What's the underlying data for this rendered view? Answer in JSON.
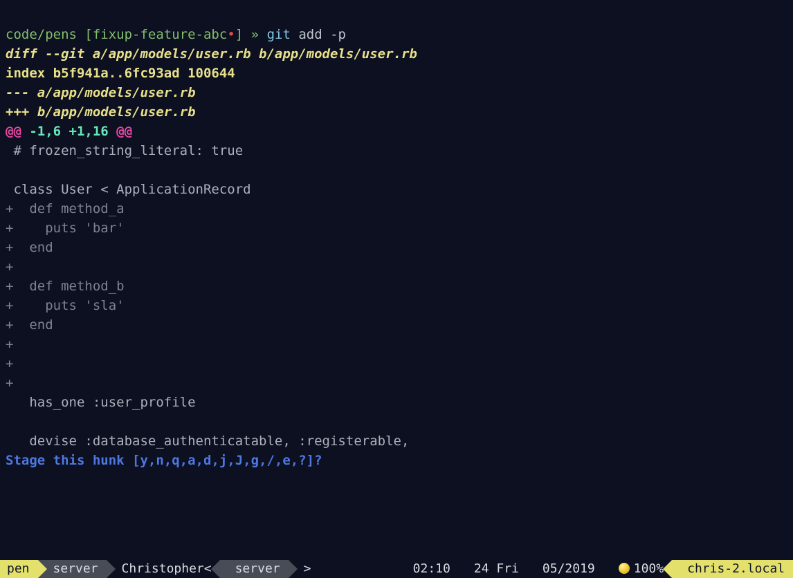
{
  "prompt": {
    "path": "code/pens",
    "branch": "fixup-feature-abc",
    "dirty_marker": "•",
    "separator": "»",
    "command_git": "git",
    "command_args": " add -p"
  },
  "diff": {
    "header1": "diff --git a/app/models/user.rb b/app/models/user.rb",
    "header2": "index b5f941a..6fc93ad 100644",
    "header3": "--- a/app/models/user.rb",
    "header4": "+++ b/app/models/user.rb",
    "hunk": {
      "at1": "@@",
      "range": " -1,6 +1,16 ",
      "at2": "@@"
    },
    "ctx1": " # frozen_string_literal: true",
    "blank": "",
    "ctx2": " class User < ApplicationRecord",
    "add1": "+  def method_a",
    "add2": "+    puts 'bar'",
    "add3": "+  end",
    "add4": "+",
    "add5": "+  def method_b",
    "add6": "+    puts 'sla'",
    "add7": "+  end",
    "add8": "+",
    "add9": "+",
    "add10": "+",
    "ctx3": "   has_one :user_profile",
    "ctx4": "   devise :database_authenticatable, :registerable,",
    "stage_prompt": "Stage this hunk [y,n,q,a,d,j,J,g,/,e,?]?"
  },
  "statusbar": {
    "left1": "pen",
    "left2": "server",
    "left3": "Christopher<",
    "left4": "server",
    "left4_tail": ">",
    "time": "02:10",
    "date": "24 Fri",
    "month": "05/2019",
    "battery": "100%",
    "host": "chris-2.local"
  }
}
